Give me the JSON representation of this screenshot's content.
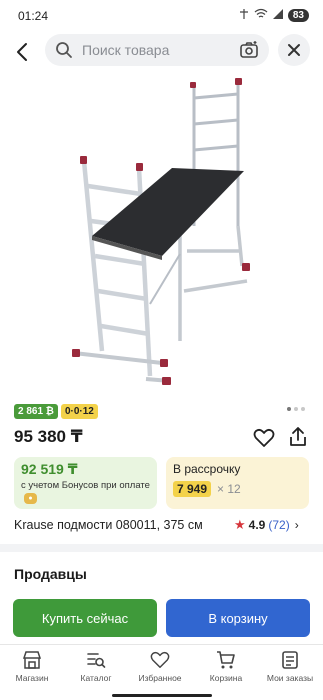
{
  "status": {
    "time": "01:24",
    "battery": "83"
  },
  "search": {
    "placeholder": "Поиск товара"
  },
  "product": {
    "image_icon": "ladder-scaffold-image",
    "bonus_badge": "2 861 ₿",
    "installment_badge": "0·0·12",
    "price": "95 380 ₸",
    "title": "Krause подмости 080011, 375 см",
    "rating_value": "4.9",
    "rating_count": "(72)"
  },
  "bonus_card": {
    "amount": "92 519 ₸",
    "note": "с учетом Бонусов при оплате"
  },
  "installment_card": {
    "title": "В рассрочку",
    "amount": "7 949",
    "months": "× 12"
  },
  "sellers": {
    "title": "Продавцы"
  },
  "actions": {
    "buy_now": "Купить сейчас",
    "add_to_cart": "В корзину"
  },
  "nav": {
    "items": [
      {
        "label": "Магазин",
        "icon": "shop-icon"
      },
      {
        "label": "Каталог",
        "icon": "catalog-icon"
      },
      {
        "label": "Избранное",
        "icon": "heart-icon"
      },
      {
        "label": "Корзина",
        "icon": "cart-icon"
      },
      {
        "label": "Мои заказы",
        "icon": "orders-icon"
      }
    ]
  },
  "colors": {
    "green": "#3f9a3a",
    "blue": "#3166d0",
    "yellow": "#f3d24a",
    "red_star": "#d6353b"
  }
}
